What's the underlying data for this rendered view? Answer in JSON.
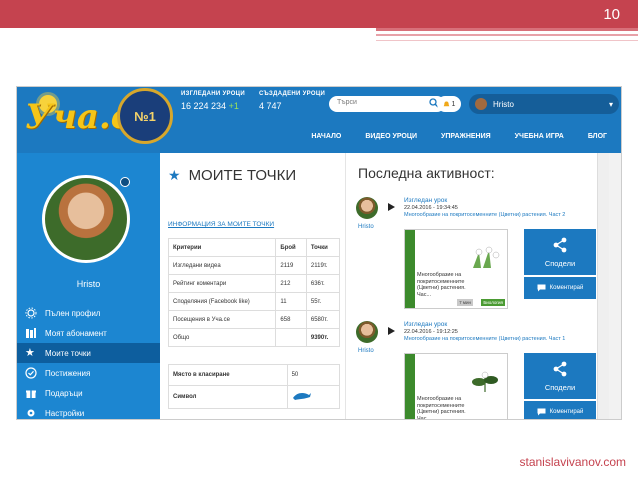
{
  "slide": {
    "page_number": "10",
    "footer_link": "stanislavivanov.com"
  },
  "header": {
    "logo_text": "Уча.се",
    "badge_number": "№1",
    "stats": [
      {
        "label": "ИЗГЛЕДАНИ УРОЦИ",
        "value": "16 224 234",
        "delta": "+1"
      },
      {
        "label": "СЪЗДАДЕНИ УРОЦИ",
        "value": "4 747",
        "delta": ""
      }
    ],
    "search_placeholder": "Търси",
    "notif_count": "1",
    "user_name": "Hristo",
    "nav": [
      "НАЧАЛО",
      "ВИДЕО УРОЦИ",
      "УПРАЖНЕНИЯ",
      "УЧЕБНА ИГРА",
      "БЛОГ"
    ]
  },
  "sidebar": {
    "name": "Hristo",
    "items": [
      {
        "label": "Пълен профил",
        "icon": "gear-icon",
        "active": false
      },
      {
        "label": "Моят абонамент",
        "icon": "books-icon",
        "active": false
      },
      {
        "label": "Моите точки",
        "icon": "star-icon",
        "active": true
      },
      {
        "label": "Постижения",
        "icon": "check-circle-icon",
        "active": false
      },
      {
        "label": "Подаръци",
        "icon": "gift-icon",
        "active": false
      },
      {
        "label": "Настройки",
        "icon": "settings-icon",
        "active": false
      }
    ]
  },
  "points": {
    "title": "МОИТЕ ТОЧКИ",
    "subtitle": "ИНФОРМАЦИЯ ЗА МОИТЕ ТОЧКИ",
    "columns": [
      "Критерии",
      "Брой",
      "Точки"
    ],
    "rows": [
      [
        "Изгледани видеа",
        "2119",
        "2119т."
      ],
      [
        "Рейтинг коментари",
        "212",
        "636т."
      ],
      [
        "Споделяния (Facebook like)",
        "11",
        "55т."
      ],
      [
        "Посещения в Уча.се",
        "658",
        "6580т."
      ]
    ],
    "total_label": "Общо",
    "total_value": "9390т.",
    "rank_label": "Място в класиране",
    "rank_value": "50",
    "symbol_label": "Символ"
  },
  "activity": {
    "title": "Последна активност:",
    "items": [
      {
        "user": "Hristo",
        "type": "Изгледан урок",
        "date": "22.04.2016 - 19:34:45",
        "desc": "Многообразие на покритосеменните (Цветни) растения. Част 2",
        "card_text": "Многообразие на покритосеменните (Цветни) растения. Час...",
        "tag_time": "7 мин",
        "tag": "Биология",
        "share": "Сподели",
        "comment": "Коментирай"
      },
      {
        "user": "Hristo",
        "type": "Изгледан урок",
        "date": "22.04.2016 - 19:12:25",
        "desc": "Многообразие на покритосеменните (Цветни) растения. Част 1",
        "card_text": "Многообразие на покритосеменните (Цветни) растения. Час...",
        "tag_time": "",
        "tag": "",
        "share": "Сподели",
        "comment": "Коментирай"
      }
    ]
  }
}
